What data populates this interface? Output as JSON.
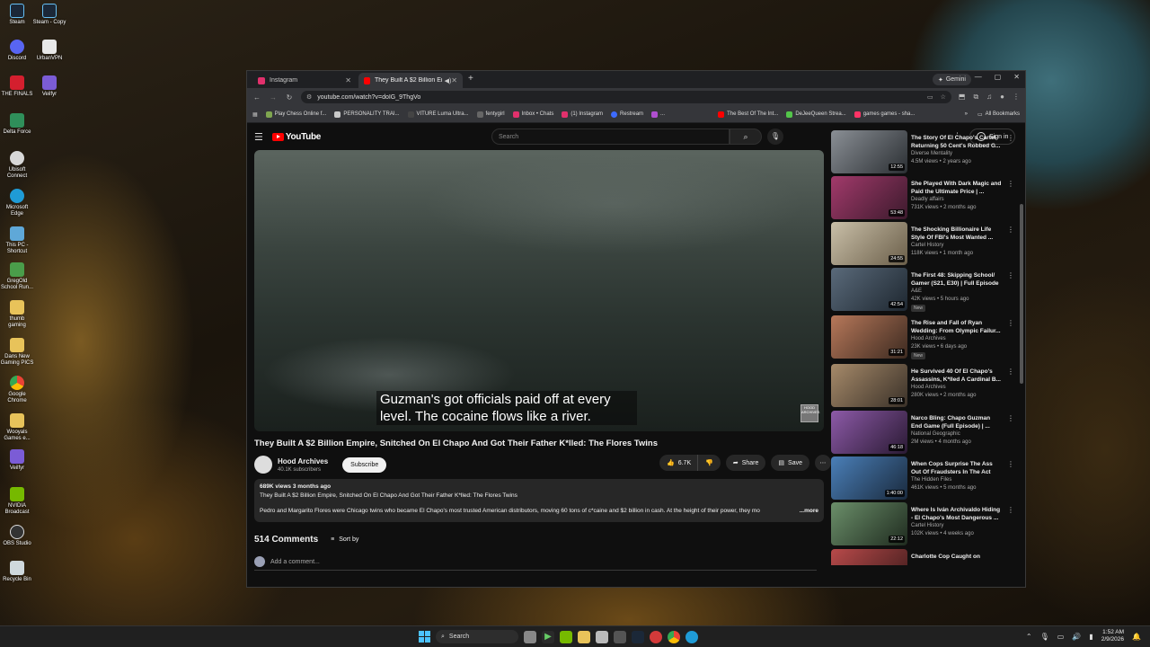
{
  "desktop": {
    "icons": [
      {
        "label": "Steam"
      },
      {
        "label": "Steam - Copy"
      },
      {
        "label": "Discord"
      },
      {
        "label": "UrbanVPN"
      },
      {
        "label": "THE FINALS"
      },
      {
        "label": "Veilfyr"
      },
      {
        "label": "Delta Force"
      },
      {
        "label": "Ubisoft Connect"
      },
      {
        "label": "Microsoft Edge"
      },
      {
        "label": "This PC - Shortcut"
      },
      {
        "label": "GregOld School Run..."
      },
      {
        "label": "thumb gaming"
      },
      {
        "label": "Dans New Gaming PICS"
      },
      {
        "label": "Google Chrome"
      },
      {
        "label": "Wooyals Games e..."
      },
      {
        "label": "Veilfyr"
      },
      {
        "label": "NVIDIA Broadcast"
      },
      {
        "label": "OBS Studio"
      },
      {
        "label": "Recycle Bin"
      }
    ]
  },
  "browser": {
    "tabs": [
      {
        "label": "Instagram",
        "color": "#e1306c",
        "active": false
      },
      {
        "label": "They Built A $2 Billion Empi",
        "color": "#ff0000",
        "active": true
      }
    ],
    "gemini_label": "Gemini",
    "url": "youtube.com/watch?v=doIG_9ThgVo",
    "bookmarks": [
      {
        "label": "Play Chess Online f...",
        "color": "#7fa650"
      },
      {
        "label": "PERSONALITY TRAI...",
        "color": "#c9c9c9"
      },
      {
        "label": "VITURE Luma Ultra...",
        "color": "#222222"
      },
      {
        "label": "fentygirl",
        "color": "#555555"
      },
      {
        "label": "Inbox • Chats",
        "color": "#e1306c"
      },
      {
        "label": "(1) Instagram",
        "color": "#e1306c"
      },
      {
        "label": "Restream",
        "color": "#3d6bff"
      },
      {
        "label": "...",
        "color": "#b04fd0"
      },
      {
        "label": "The Best Of The Int...",
        "color": "#ff0000"
      },
      {
        "label": "DeJeeQueen Strea...",
        "color": "#53c54a"
      },
      {
        "label": "games games - sha...",
        "color": "#ff3366"
      }
    ],
    "all_bookmarks": "All Bookmarks"
  },
  "youtube": {
    "logo_text": "YouTube",
    "search_placeholder": "Search",
    "sign_in": "Sign in",
    "caption": "Guzman's got officials paid off at every level. The cocaine flows like a river.",
    "watermark": "HOOD ARCHIVES",
    "video_title": "They Built A $2 Billion Empire, Snitched On El Chapo And Got Their Father K*lled: The Flores Twins",
    "channel_name": "Hood Archives",
    "channel_subs": "40.1K subscribers",
    "subscribe": "Subscribe",
    "likes": "6.7K",
    "share": "Share",
    "save": "Save",
    "desc_meta": "689K views  3 months ago",
    "desc_title": "They Built A $2 Billion Empire, Snitched On El Chapo And Got Their Father K*lled: The Flores Twins",
    "desc_body": "Pedro and Margarito Flores were Chicago twins who became El Chapo's most trusted American distributors, moving 60 tons of c*caine and $2 billion in cash. At the height of their power, they mo",
    "desc_more": "...more",
    "comments_count": "514 Comments",
    "sort_by": "Sort by",
    "add_comment": "Add a comment..."
  },
  "recommendations": [
    {
      "title": "The Story Of El Chapo's Cartel Returning 50 Cent's Robbed G...",
      "channel": "Diverse Mentality",
      "stats": "4.5M views • 2 years ago",
      "duration": "12:55",
      "badge": "",
      "thumb_a": "#8a8f95",
      "thumb_b": "#2b2f33"
    },
    {
      "title": "She Played With Dark Magic and Paid the Ultimate Price | ...",
      "channel": "Deadly affairs",
      "stats": "731K views • 2 months ago",
      "duration": "53:48",
      "badge": "",
      "thumb_a": "#a23a6b",
      "thumb_b": "#3b1a2c"
    },
    {
      "title": "The Shocking Billionaire Life Style Of FBI's Most Wanted ...",
      "channel": "Cartel History",
      "stats": "118K views • 1 month ago",
      "duration": "24:55",
      "badge": "",
      "thumb_a": "#c9bfa8",
      "thumb_b": "#6b5f4a"
    },
    {
      "title": "The First 48: Skipping School/ Gamer (S21, E30) | Full Episode",
      "channel": "A&E",
      "stats": "42K views • 5 hours ago",
      "duration": "42:54",
      "badge": "New",
      "thumb_a": "#5a6a7a",
      "thumb_b": "#1e2730"
    },
    {
      "title": "The Rise and Fall of Ryan Wedding: From Olympic Failur...",
      "channel": "Hood Archives",
      "stats": "23K views • 6 days ago",
      "duration": "31:21",
      "badge": "New",
      "thumb_a": "#b7785a",
      "thumb_b": "#3c2a20"
    },
    {
      "title": "He Survived 40 Of El Chapo's Assassins, K*lled A Cardinal B...",
      "channel": "Hood Archives",
      "stats": "280K views • 2 months ago",
      "duration": "28:01",
      "badge": "",
      "thumb_a": "#a68a6a",
      "thumb_b": "#3a3128"
    },
    {
      "title": "Narco Bling: Chapo Guzman End Game (Full Episode) | ...",
      "channel": "National Geographic",
      "stats": "2M views • 4 months ago",
      "duration": "46:18",
      "badge": "",
      "thumb_a": "#8d5aa8",
      "thumb_b": "#2a1a33"
    },
    {
      "title": "When Cops Surprise The Ass Out Of Fraudsters In The Act",
      "channel": "The Hidden Files",
      "stats": "461K views • 5 months ago",
      "duration": "1:40:00",
      "badge": "",
      "thumb_a": "#4a7fb8",
      "thumb_b": "#1a2a3d"
    },
    {
      "title": "Where Is Iván Archivaldo Hiding - El Chapo's Most Dangerous ...",
      "channel": "Cartel History",
      "stats": "102K views • 4 weeks ago",
      "duration": "22:12",
      "badge": "",
      "thumb_a": "#6b8f6a",
      "thumb_b": "#1f2b1f"
    },
    {
      "title": "Charlotte Cop Caught on",
      "channel": "",
      "stats": "",
      "duration": "",
      "badge": "",
      "thumb_a": "#b84a4a",
      "thumb_b": "#3a1a1a"
    }
  ],
  "taskbar": {
    "search_label": "Search",
    "time": "1:52 AM",
    "date": "2/9/2026"
  }
}
